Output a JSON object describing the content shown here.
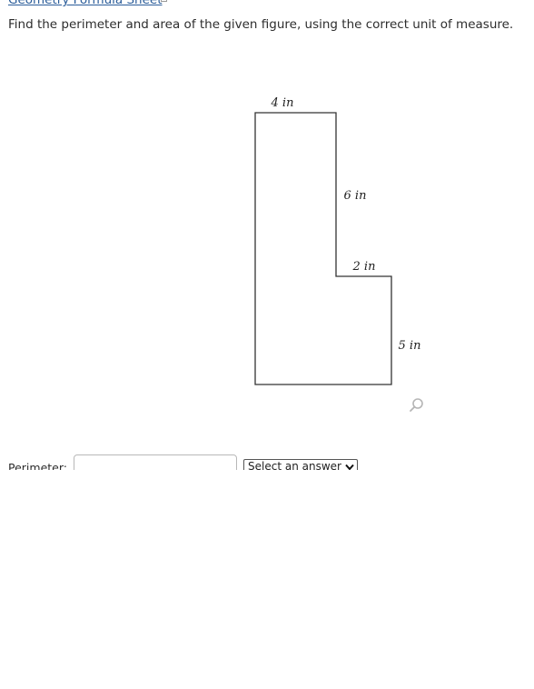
{
  "header": {
    "formula_sheet_link": "Geometry Formula Sheet",
    "external_link_icon": "external-link-icon"
  },
  "question": {
    "prompt": "Find the perimeter and area of the given figure, using the correct unit of measure."
  },
  "figure": {
    "labels": {
      "top": "4 in",
      "inner_vertical": "6 in",
      "step": "2 in",
      "right": "5 in"
    },
    "zoom_icon": "magnifier-icon"
  },
  "answers": {
    "perimeter_label": "Perimeter:",
    "perimeter_value": "",
    "unit_select_value": "Select an answer"
  },
  "colors": {
    "link": "#2b5d9a",
    "text": "#2d2d2d",
    "figure_stroke": "#333333"
  }
}
